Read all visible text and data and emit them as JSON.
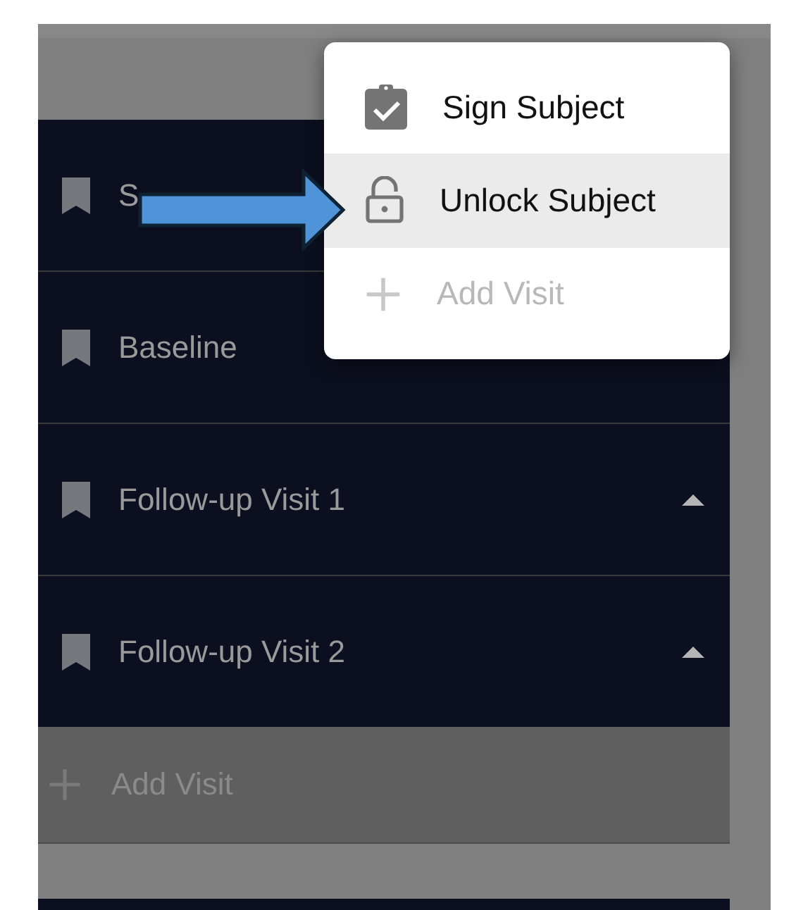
{
  "visits": [
    {
      "label": "S"
    },
    {
      "label": "Baseline"
    },
    {
      "label": "Follow-up Visit 1",
      "expanded": true
    },
    {
      "label": "Follow-up Visit 2",
      "expanded": true
    }
  ],
  "add_visit": {
    "label": "Add Visit",
    "disabled": true
  },
  "menu": {
    "items": [
      {
        "kind": "sign",
        "label": "Sign Subject",
        "selected": false,
        "disabled": false
      },
      {
        "kind": "unlock",
        "label": "Unlock Subject",
        "selected": true,
        "disabled": false
      },
      {
        "kind": "add",
        "label": "Add Visit",
        "selected": false,
        "disabled": true
      }
    ]
  },
  "annotation": {
    "kind": "arrow"
  }
}
